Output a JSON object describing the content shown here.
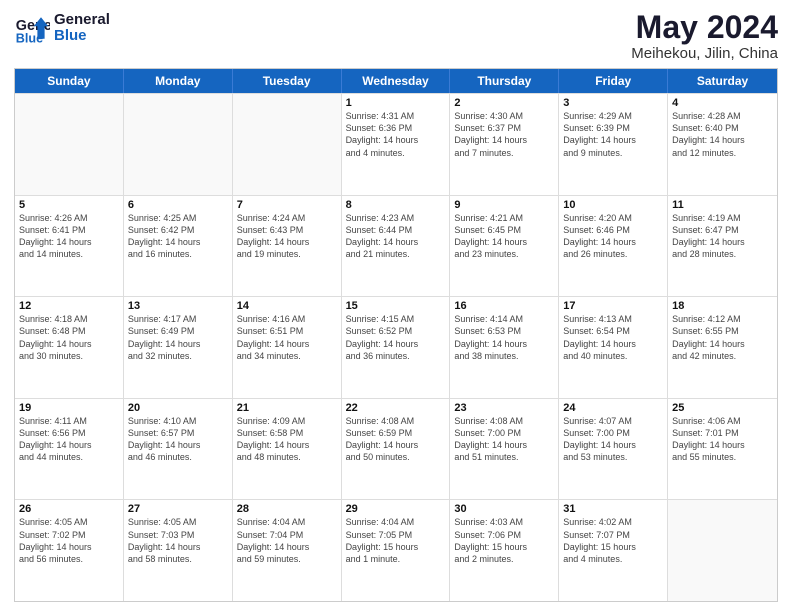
{
  "header": {
    "logo_line1": "General",
    "logo_line2": "Blue",
    "main_title": "May 2024",
    "subtitle": "Meihekou, Jilin, China"
  },
  "weekdays": [
    "Sunday",
    "Monday",
    "Tuesday",
    "Wednesday",
    "Thursday",
    "Friday",
    "Saturday"
  ],
  "rows": [
    [
      {
        "day": "",
        "info": "",
        "empty": true
      },
      {
        "day": "",
        "info": "",
        "empty": true
      },
      {
        "day": "",
        "info": "",
        "empty": true
      },
      {
        "day": "1",
        "info": "Sunrise: 4:31 AM\nSunset: 6:36 PM\nDaylight: 14 hours\nand 4 minutes.",
        "empty": false
      },
      {
        "day": "2",
        "info": "Sunrise: 4:30 AM\nSunset: 6:37 PM\nDaylight: 14 hours\nand 7 minutes.",
        "empty": false
      },
      {
        "day": "3",
        "info": "Sunrise: 4:29 AM\nSunset: 6:39 PM\nDaylight: 14 hours\nand 9 minutes.",
        "empty": false
      },
      {
        "day": "4",
        "info": "Sunrise: 4:28 AM\nSunset: 6:40 PM\nDaylight: 14 hours\nand 12 minutes.",
        "empty": false
      }
    ],
    [
      {
        "day": "5",
        "info": "Sunrise: 4:26 AM\nSunset: 6:41 PM\nDaylight: 14 hours\nand 14 minutes.",
        "empty": false
      },
      {
        "day": "6",
        "info": "Sunrise: 4:25 AM\nSunset: 6:42 PM\nDaylight: 14 hours\nand 16 minutes.",
        "empty": false
      },
      {
        "day": "7",
        "info": "Sunrise: 4:24 AM\nSunset: 6:43 PM\nDaylight: 14 hours\nand 19 minutes.",
        "empty": false
      },
      {
        "day": "8",
        "info": "Sunrise: 4:23 AM\nSunset: 6:44 PM\nDaylight: 14 hours\nand 21 minutes.",
        "empty": false
      },
      {
        "day": "9",
        "info": "Sunrise: 4:21 AM\nSunset: 6:45 PM\nDaylight: 14 hours\nand 23 minutes.",
        "empty": false
      },
      {
        "day": "10",
        "info": "Sunrise: 4:20 AM\nSunset: 6:46 PM\nDaylight: 14 hours\nand 26 minutes.",
        "empty": false
      },
      {
        "day": "11",
        "info": "Sunrise: 4:19 AM\nSunset: 6:47 PM\nDaylight: 14 hours\nand 28 minutes.",
        "empty": false
      }
    ],
    [
      {
        "day": "12",
        "info": "Sunrise: 4:18 AM\nSunset: 6:48 PM\nDaylight: 14 hours\nand 30 minutes.",
        "empty": false
      },
      {
        "day": "13",
        "info": "Sunrise: 4:17 AM\nSunset: 6:49 PM\nDaylight: 14 hours\nand 32 minutes.",
        "empty": false
      },
      {
        "day": "14",
        "info": "Sunrise: 4:16 AM\nSunset: 6:51 PM\nDaylight: 14 hours\nand 34 minutes.",
        "empty": false
      },
      {
        "day": "15",
        "info": "Sunrise: 4:15 AM\nSunset: 6:52 PM\nDaylight: 14 hours\nand 36 minutes.",
        "empty": false
      },
      {
        "day": "16",
        "info": "Sunrise: 4:14 AM\nSunset: 6:53 PM\nDaylight: 14 hours\nand 38 minutes.",
        "empty": false
      },
      {
        "day": "17",
        "info": "Sunrise: 4:13 AM\nSunset: 6:54 PM\nDaylight: 14 hours\nand 40 minutes.",
        "empty": false
      },
      {
        "day": "18",
        "info": "Sunrise: 4:12 AM\nSunset: 6:55 PM\nDaylight: 14 hours\nand 42 minutes.",
        "empty": false
      }
    ],
    [
      {
        "day": "19",
        "info": "Sunrise: 4:11 AM\nSunset: 6:56 PM\nDaylight: 14 hours\nand 44 minutes.",
        "empty": false
      },
      {
        "day": "20",
        "info": "Sunrise: 4:10 AM\nSunset: 6:57 PM\nDaylight: 14 hours\nand 46 minutes.",
        "empty": false
      },
      {
        "day": "21",
        "info": "Sunrise: 4:09 AM\nSunset: 6:58 PM\nDaylight: 14 hours\nand 48 minutes.",
        "empty": false
      },
      {
        "day": "22",
        "info": "Sunrise: 4:08 AM\nSunset: 6:59 PM\nDaylight: 14 hours\nand 50 minutes.",
        "empty": false
      },
      {
        "day": "23",
        "info": "Sunrise: 4:08 AM\nSunset: 7:00 PM\nDaylight: 14 hours\nand 51 minutes.",
        "empty": false
      },
      {
        "day": "24",
        "info": "Sunrise: 4:07 AM\nSunset: 7:00 PM\nDaylight: 14 hours\nand 53 minutes.",
        "empty": false
      },
      {
        "day": "25",
        "info": "Sunrise: 4:06 AM\nSunset: 7:01 PM\nDaylight: 14 hours\nand 55 minutes.",
        "empty": false
      }
    ],
    [
      {
        "day": "26",
        "info": "Sunrise: 4:05 AM\nSunset: 7:02 PM\nDaylight: 14 hours\nand 56 minutes.",
        "empty": false
      },
      {
        "day": "27",
        "info": "Sunrise: 4:05 AM\nSunset: 7:03 PM\nDaylight: 14 hours\nand 58 minutes.",
        "empty": false
      },
      {
        "day": "28",
        "info": "Sunrise: 4:04 AM\nSunset: 7:04 PM\nDaylight: 14 hours\nand 59 minutes.",
        "empty": false
      },
      {
        "day": "29",
        "info": "Sunrise: 4:04 AM\nSunset: 7:05 PM\nDaylight: 15 hours\nand 1 minute.",
        "empty": false
      },
      {
        "day": "30",
        "info": "Sunrise: 4:03 AM\nSunset: 7:06 PM\nDaylight: 15 hours\nand 2 minutes.",
        "empty": false
      },
      {
        "day": "31",
        "info": "Sunrise: 4:02 AM\nSunset: 7:07 PM\nDaylight: 15 hours\nand 4 minutes.",
        "empty": false
      },
      {
        "day": "",
        "info": "",
        "empty": true
      }
    ]
  ]
}
